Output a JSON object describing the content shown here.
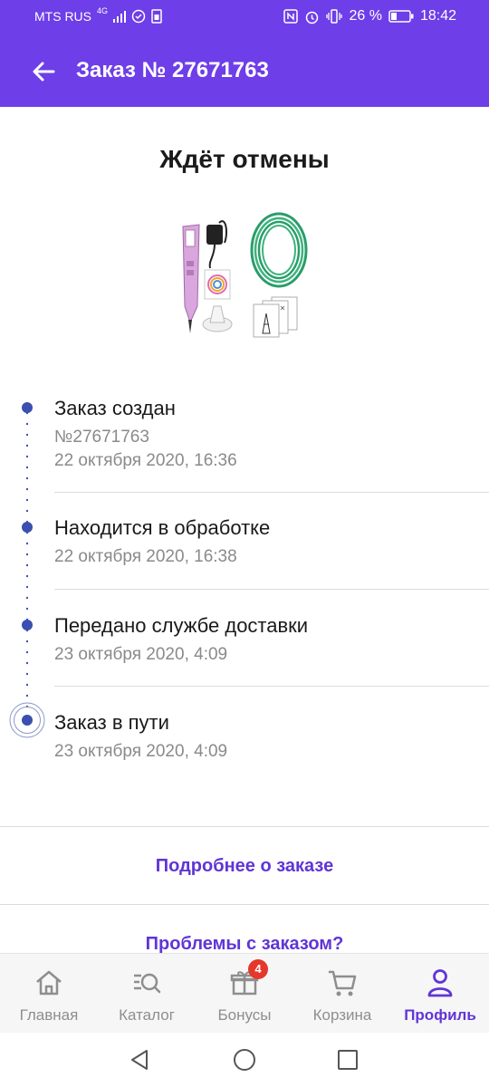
{
  "status_bar": {
    "carrier": "MTS RUS",
    "network": "4G",
    "battery": "26 %",
    "time": "18:42"
  },
  "app_bar": {
    "title": "Заказ № 27671763"
  },
  "order": {
    "status_title": "Ждёт отмены",
    "steps": [
      {
        "title": "Заказ создан",
        "lines": [
          "№27671763",
          "22 октября 2020, 16:36"
        ]
      },
      {
        "title": "Находится в обработке",
        "lines": [
          "22 октября 2020, 16:38"
        ]
      },
      {
        "title": "Передано службе доставки",
        "lines": [
          "23 октября 2020, 4:09"
        ]
      },
      {
        "title": "Заказ в пути",
        "lines": [
          "23 октября 2020, 4:09"
        ]
      }
    ]
  },
  "links": {
    "details": "Подробнее о заказе",
    "problems": "Проблемы с заказом?"
  },
  "bottom_nav": {
    "items": [
      {
        "label": "Главная",
        "icon": "home-icon"
      },
      {
        "label": "Каталог",
        "icon": "catalog-search-icon"
      },
      {
        "label": "Бонусы",
        "icon": "gift-icon",
        "badge": "4"
      },
      {
        "label": "Корзина",
        "icon": "cart-icon"
      },
      {
        "label": "Профиль",
        "icon": "profile-icon"
      }
    ]
  },
  "colors": {
    "accent": "#6e3ee8",
    "link": "#6035d6",
    "timeline": "#3a4fb0",
    "badge": "#e5372b"
  }
}
